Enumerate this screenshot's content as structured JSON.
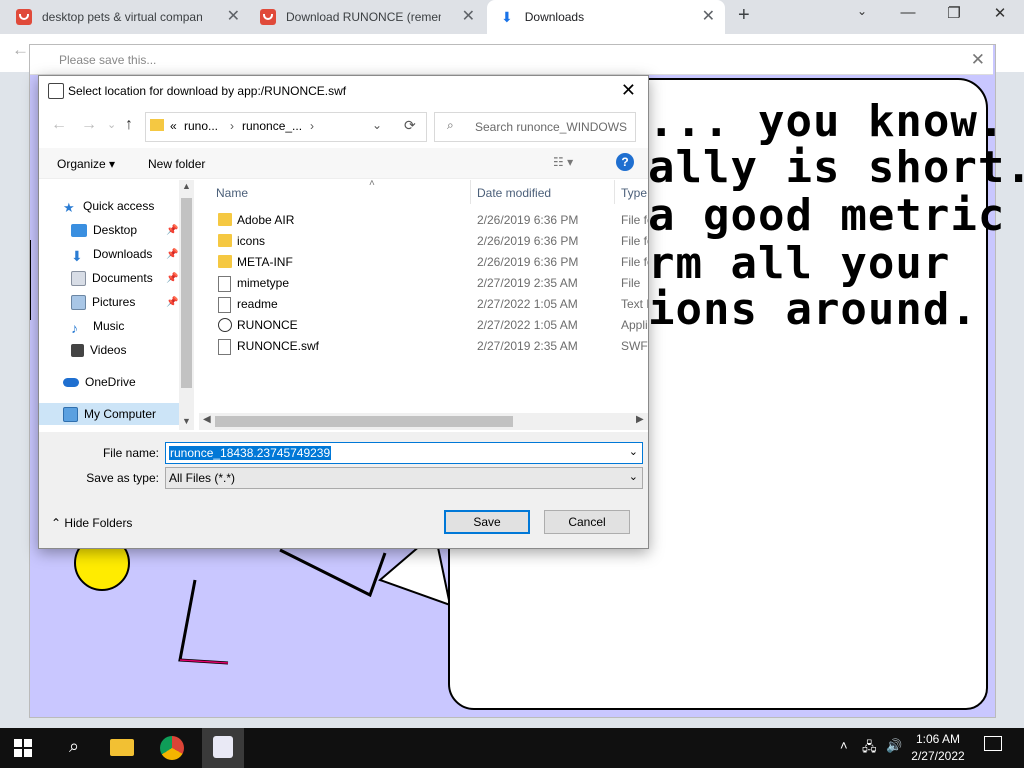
{
  "browser": {
    "tabs": [
      {
        "title": "desktop pets & virtual companio",
        "active": false
      },
      {
        "title": "Download RUNONCE (remembe",
        "active": false
      },
      {
        "title": "Downloads",
        "active": true
      }
    ],
    "new_tab": "+"
  },
  "app": {
    "title": "Please save this...",
    "bubble_lines": [
      "... you know.",
      "ally is short.",
      "a good metric",
      "rm all your",
      "ions around."
    ]
  },
  "dialog": {
    "title": "Select location for download by app:/RUNONCE.swf",
    "address": {
      "prefix": "«",
      "crumbs": [
        "runo...",
        "runonce_..."
      ]
    },
    "search_placeholder": "Search runonce_WINDOWS",
    "organize": "Organize",
    "new_folder": "New folder",
    "help": "?",
    "nav": [
      {
        "label": "Quick access",
        "icon": "star-icon"
      },
      {
        "label": "Desktop",
        "icon": "desktop-icon"
      },
      {
        "label": "Downloads",
        "icon": "downloads-icon"
      },
      {
        "label": "Documents",
        "icon": "documents-icon"
      },
      {
        "label": "Pictures",
        "icon": "pictures-icon"
      },
      {
        "label": "Music",
        "icon": "music-icon"
      },
      {
        "label": "Videos",
        "icon": "videos-icon"
      },
      {
        "label": "OneDrive",
        "icon": "cloud-icon"
      },
      {
        "label": "My Computer",
        "icon": "computer-icon"
      }
    ],
    "columns": {
      "name": "Name",
      "date": "Date modified",
      "type": "Type"
    },
    "files": [
      {
        "name": "Adobe AIR",
        "date": "2/26/2019 6:36 PM",
        "type": "File fo",
        "kind": "folder"
      },
      {
        "name": "icons",
        "date": "2/26/2019 6:36 PM",
        "type": "File fo",
        "kind": "folder"
      },
      {
        "name": "META-INF",
        "date": "2/26/2019 6:36 PM",
        "type": "File fo",
        "kind": "folder"
      },
      {
        "name": "mimetype",
        "date": "2/27/2019 2:35 AM",
        "type": "File",
        "kind": "file"
      },
      {
        "name": "readme",
        "date": "2/27/2022 1:05 AM",
        "type": "Text D",
        "kind": "file"
      },
      {
        "name": "RUNONCE",
        "date": "2/27/2022 1:05 AM",
        "type": "Applic",
        "kind": "app"
      },
      {
        "name": "RUNONCE.swf",
        "date": "2/27/2019 2:35 AM",
        "type": "SWF",
        "kind": "file"
      }
    ],
    "file_name_label": "File name:",
    "file_name_value": "runonce_18438.23745749239",
    "save_type_label": "Save as type:",
    "save_type_value": "All Files (*.*)",
    "hide_folders": "Hide Folders",
    "save": "Save",
    "cancel": "Cancel"
  },
  "taskbar": {
    "time": "1:06 AM",
    "date": "2/27/2022"
  }
}
